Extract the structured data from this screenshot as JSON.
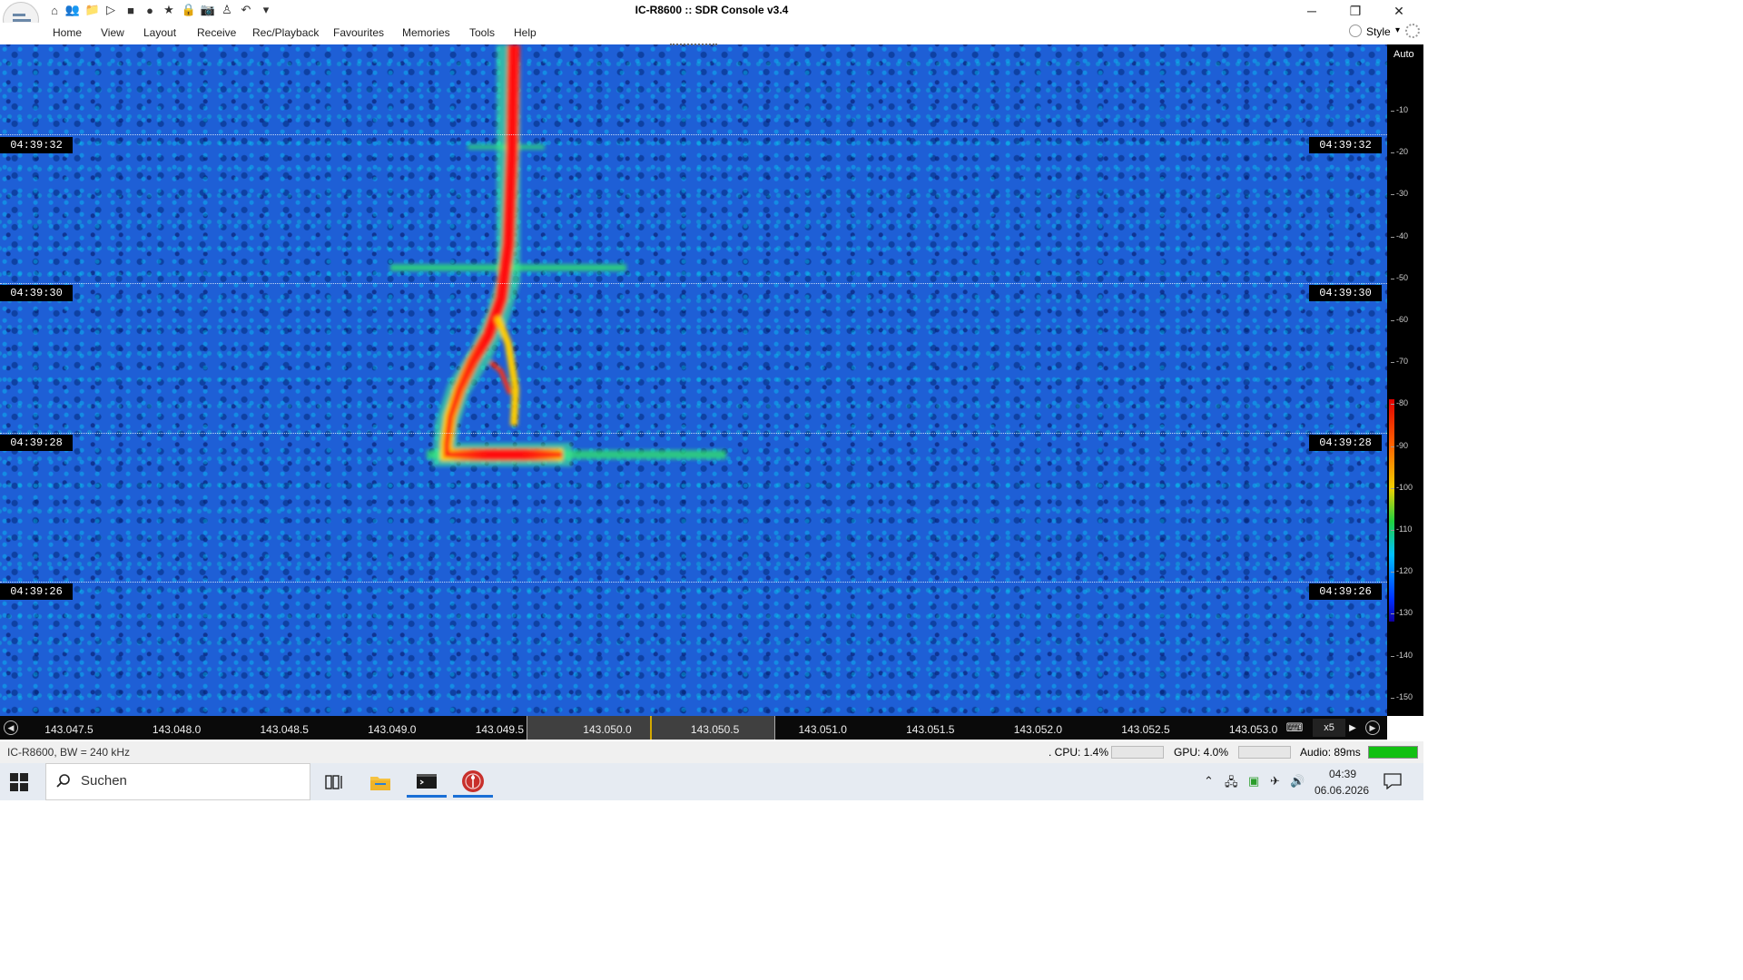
{
  "window": {
    "title": "IC-R8600 :: SDR Console v3.4",
    "minimize": "─",
    "restore": "❐",
    "close": "✕"
  },
  "quick_access": {
    "icons": [
      "home-icon",
      "users-icon",
      "folder-icon",
      "play-icon",
      "stop-icon",
      "record-icon",
      "star-icon",
      "lock-icon",
      "camera-icon",
      "antenna-icon",
      "undo-icon",
      "dropdown-icon"
    ],
    "glyphs": [
      "⌂",
      "👥",
      "📁",
      "▷",
      "■",
      "●",
      "★",
      "🔒",
      "📷",
      "♙",
      "↶",
      "▾"
    ]
  },
  "menu": {
    "items": [
      "Home",
      "View",
      "Layout",
      "Receive",
      "Rec/Playback",
      "Favourites",
      "Memories",
      "Tools",
      "Help"
    ],
    "style_label": "Style",
    "style_arrow": "▾"
  },
  "waterfall": {
    "timestamps": [
      "04:39:32",
      "04:39:30",
      "04:39:28",
      "04:39:26"
    ]
  },
  "db_scale": {
    "mode": "Auto",
    "ticks": [
      "-10",
      "-20",
      "-30",
      "-40",
      "-50",
      "-60",
      "-70",
      "-80",
      "-90",
      "-100",
      "-110",
      "-120",
      "-130",
      "-140",
      "-150"
    ]
  },
  "freq_axis": {
    "labels": [
      "143.047.5",
      "143.048.0",
      "143.048.5",
      "143.049.0",
      "143.049.5",
      "143.050.0",
      "143.050.5",
      "143.051.0",
      "143.051.5",
      "143.052.0",
      "143.052.5",
      "143.053.0"
    ],
    "zoom": "x5",
    "left_glyph": "◀",
    "right_glyph": "▶",
    "next_glyph": "▶",
    "keyboard_glyph": "⌨"
  },
  "status": {
    "left": "IC-R8600, BW = 240 kHz",
    "cpu": ". CPU: 1.4%",
    "gpu": "GPU: 4.0%",
    "audio": "Audio: 89ms",
    "audio_level": 1.0
  },
  "taskbar": {
    "search_placeholder": "Suchen",
    "time": "04:39",
    "date": "06.06.2026",
    "tray_glyphs": [
      "⌃",
      "🖧",
      "▣",
      "✈",
      "🔊"
    ]
  },
  "colors": {
    "signal_hot": "#ff1a1a",
    "signal_warm": "#ffcc00",
    "waterfall_base": "#1e5fd6",
    "accent": "#1a6fd6"
  }
}
